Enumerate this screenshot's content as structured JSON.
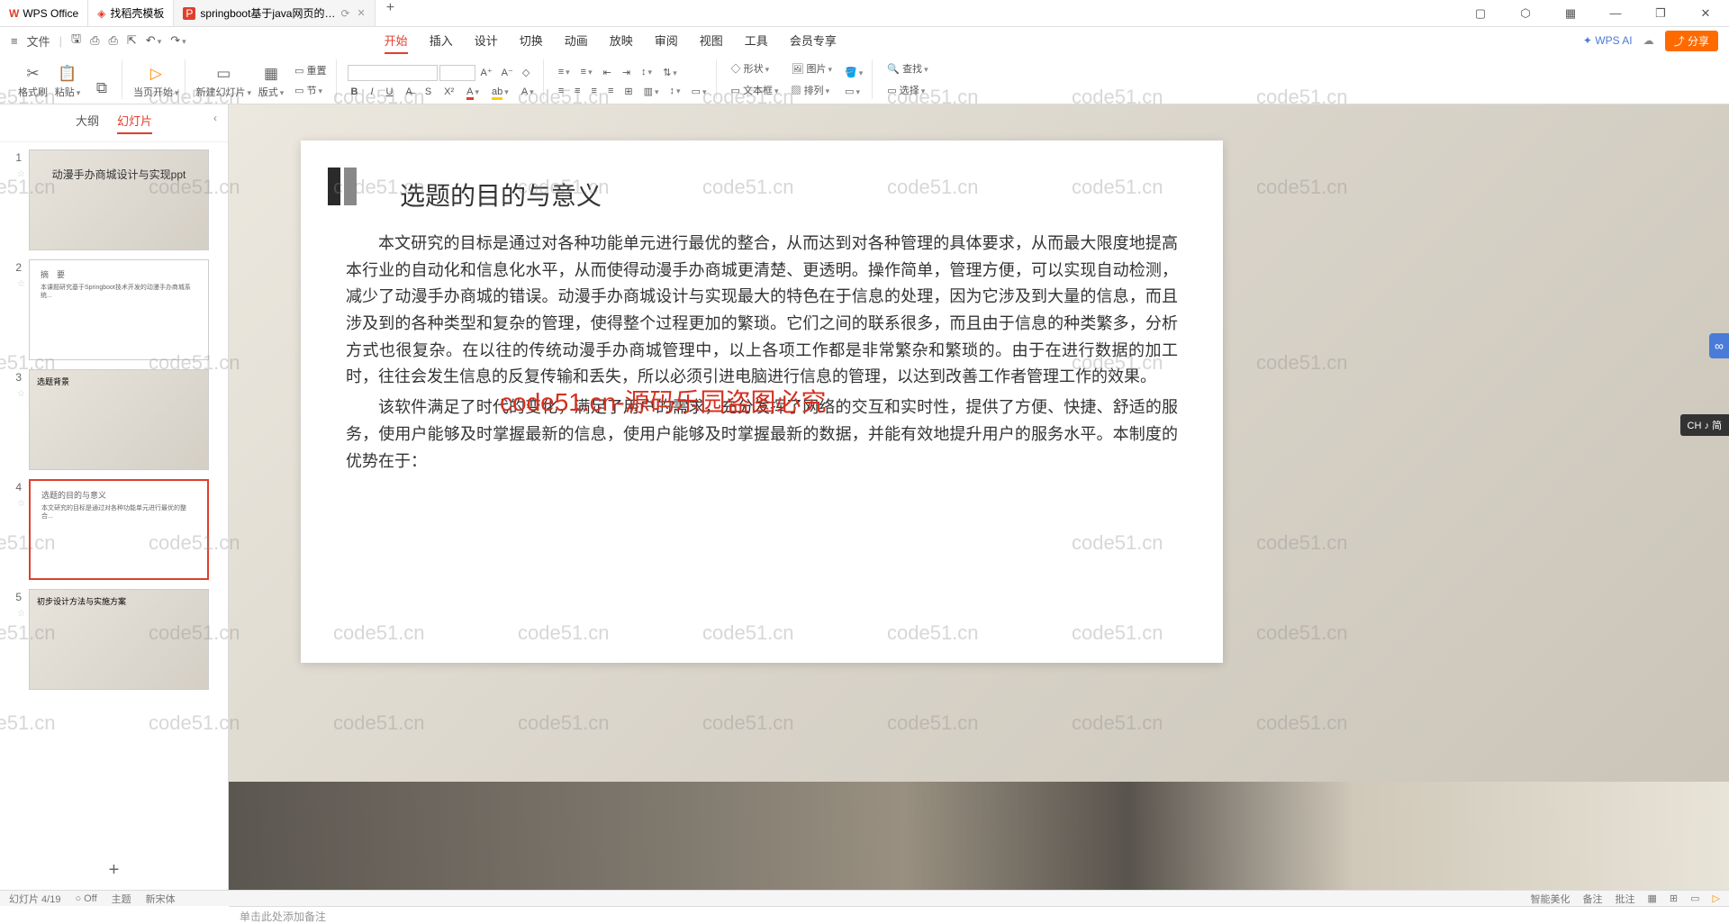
{
  "titlebar": {
    "app_name": "WPS Office",
    "tabs": [
      {
        "label": "找稻壳模板",
        "icon_color": "#e03e2d"
      },
      {
        "label": "springboot基于java网页的…",
        "icon": "P"
      }
    ],
    "add": "+"
  },
  "menubar": {
    "file": "文件",
    "tabs": [
      "开始",
      "插入",
      "设计",
      "切换",
      "动画",
      "放映",
      "审阅",
      "视图",
      "工具",
      "会员专享"
    ],
    "active_tab": "开始",
    "wps_ai": "WPS AI",
    "share": "分享"
  },
  "ribbon": {
    "format_painter": "格式刷",
    "paste": "粘贴",
    "from_start": "当页开始",
    "new_slide": "新建幻灯片",
    "layout": "版式",
    "section": "节",
    "reset": "重置",
    "shape": "形状",
    "picture": "图片",
    "textbox": "文本框",
    "arrange": "排列",
    "find": "查找",
    "select": "选择"
  },
  "panel": {
    "tab_outline": "大纲",
    "tab_slides": "幻灯片",
    "slides": [
      {
        "num": "1",
        "title": "动漫手办商城设计与实现ppt",
        "type": "cover"
      },
      {
        "num": "2",
        "title": "摘　要",
        "type": "text"
      },
      {
        "num": "3",
        "title": "选题背景",
        "type": "bg"
      },
      {
        "num": "4",
        "title": "选题的目的与意义",
        "type": "text",
        "active": true
      },
      {
        "num": "5",
        "title": "初步设计方法与实施方案",
        "type": "bg"
      }
    ],
    "add": "+"
  },
  "slide": {
    "heading": "选题的目的与意义",
    "p1": "本文研究的目标是通过对各种功能单元进行最优的整合，从而达到对各种管理的具体要求，从而最大限度地提高本行业的自动化和信息化水平，从而使得动漫手办商城更清楚、更透明。操作简单，管理方便，可以实现自动检测，减少了动漫手办商城的错误。动漫手办商城设计与实现最大的特色在于信息的处理，因为它涉及到大量的信息，而且涉及到的各种类型和复杂的管理，使得整个过程更加的繁琐。它们之间的联系很多，而且由于信息的种类繁多，分析方式也很复杂。在以往的传统动漫手办商城管理中，以上各项工作都是非常繁杂和繁琐的。由于在进行数据的加工时，往往会发生信息的反复传输和丢失，所以必须引进电脑进行信息的管理，以达到改善工作者管理工作的效果。",
    "p2": "该软件满足了时代的变化，满足了用户的需求，充分发挥了网络的交互和实时性，提供了方便、快捷、舒适的服务，使用户能够及时掌握最新的信息，使用户能够及时掌握最新的数据，并能有效地提升用户的服务水平。本制度的优势在于："
  },
  "notes": {
    "placeholder": "单击此处添加备注"
  },
  "statusbar": {
    "left": [
      "幻灯片 4/19",
      "○ Off",
      "主题",
      "新宋体"
    ],
    "right": [
      "智能美化",
      "备注",
      "批注"
    ]
  },
  "watermark_text": "code51.cn",
  "watermark_red": "code51.cn-源码乐园盗图必究",
  "float": {
    "badge": "∞",
    "lang": "CH ♪ 简"
  }
}
